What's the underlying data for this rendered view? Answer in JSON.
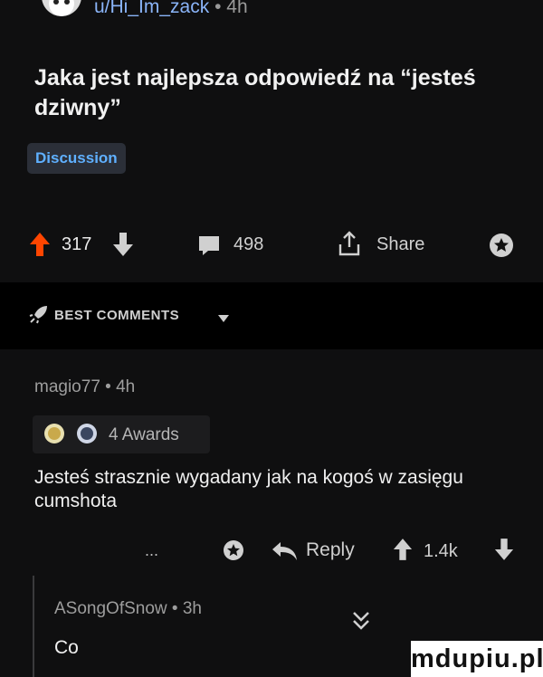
{
  "post": {
    "author": "u/Hi_Im_zack",
    "separator": "•",
    "age": "4h",
    "title": "Jaka jest najlepsza odpowiedź na “jesteś dziwny”",
    "flair": "Discussion",
    "votes": "317",
    "comments_count": "498",
    "share_label": "Share"
  },
  "best_comments": {
    "label": "BEST COMMENTS"
  },
  "comment": {
    "author": "magio77",
    "separator": "•",
    "age": "4h",
    "awards_label": "4 Awards",
    "body": "Jesteś strasznie wygadany jak na kogoś w zasięgu cumshota",
    "more_label": "...",
    "reply_label": "Reply",
    "votes": "1.4k"
  },
  "reply": {
    "author": "ASongOfSnow",
    "separator": "•",
    "age": "3h",
    "body": "Co"
  },
  "watermark": "mdupiu.pl",
  "colors": {
    "upvote": "#ff4500",
    "flair": "#5fb0ff",
    "background": "#0f0f10"
  }
}
